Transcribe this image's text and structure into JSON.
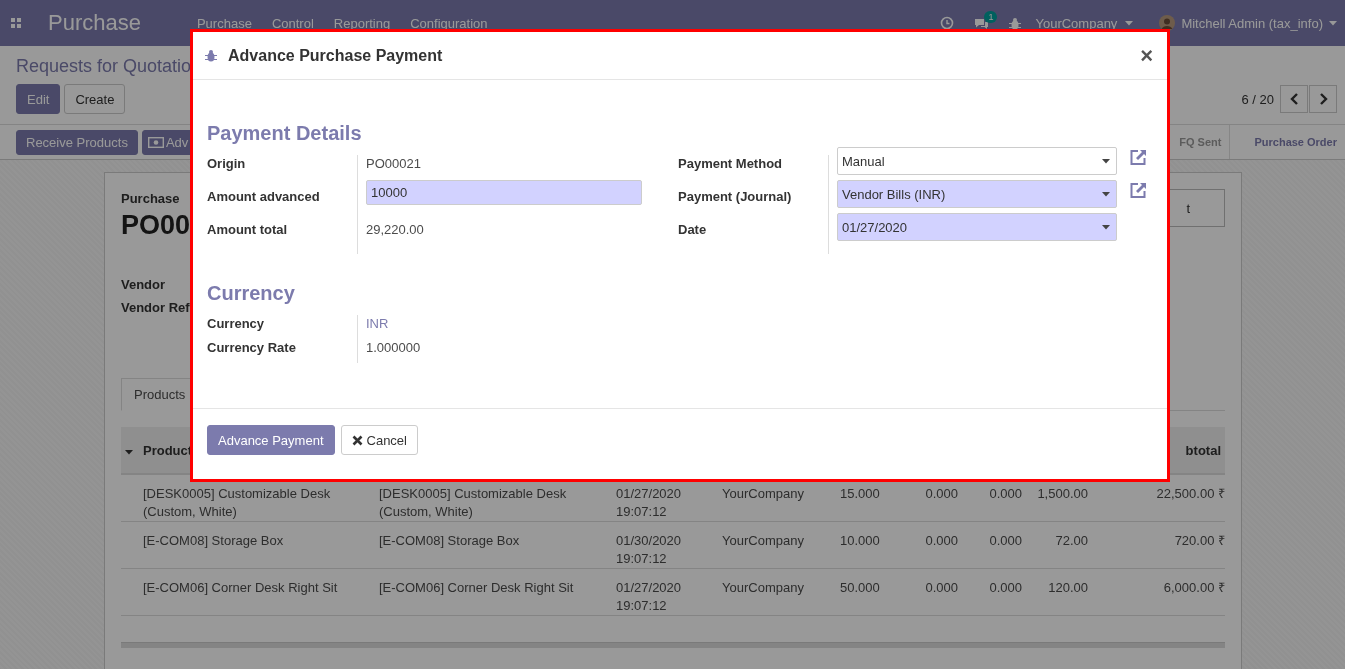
{
  "navbar": {
    "app_title": "Purchase",
    "menu": [
      "Purchase",
      "Control",
      "Reporting",
      "Configuration"
    ],
    "chat_count": "1",
    "company": "YourCompany",
    "user": "Mitchell Admin (tax_info)"
  },
  "control_panel": {
    "breadcrumb": "Requests for Quotatio",
    "buttons": [
      {
        "label": "Edit",
        "kind": "primary"
      },
      {
        "label": "Create",
        "kind": "secondary"
      }
    ],
    "pager": "6 / 20"
  },
  "action_bar": {
    "buttons": [
      {
        "label": "Receive Products",
        "kind": "plain"
      },
      {
        "label": "Adv",
        "kind": "money"
      }
    ],
    "statusbar": [
      {
        "label": "FQ Sent",
        "selected": false
      },
      {
        "label": "Purchase Order",
        "selected": true
      }
    ]
  },
  "sheet": {
    "subtitle": "Purchase",
    "name": "PO00",
    "fields": [
      "Vendor",
      "Vendor Ref"
    ],
    "smart_button": "t",
    "tabs": [
      {
        "label": "Products",
        "selected": true
      }
    ],
    "table": {
      "columns": [
        "Product",
        "btotal"
      ],
      "rows": [
        {
          "product": "[DESK0005] Customizable Desk (Custom, White)",
          "description": "[DESK0005] Customizable Desk (Custom, White)",
          "date": "01/27/2020 19:07:12",
          "company": "YourCompany",
          "qty": "15.000",
          "col_6": "0.000",
          "col_7": "0.000",
          "price": "1,500.00",
          "subtotal": "22,500.00 ₹"
        },
        {
          "product": "[E-COM08] Storage Box",
          "description": "[E-COM08] Storage Box",
          "date": "01/30/2020 19:07:12",
          "company": "YourCompany",
          "qty": "10.000",
          "col_6": "0.000",
          "col_7": "0.000",
          "price": "72.00",
          "subtotal": "720.00 ₹"
        },
        {
          "product": "[E-COM06] Corner Desk Right Sit",
          "description": "[E-COM06] Corner Desk Right Sit",
          "date": "01/27/2020 19:07:12",
          "company": "YourCompany",
          "qty": "50.000",
          "col_6": "0.000",
          "col_7": "0.000",
          "price": "120.00",
          "subtotal": "6,000.00 ₹"
        }
      ]
    }
  },
  "dialog": {
    "title": "Advance Purchase Payment",
    "close": "×",
    "sections": [
      {
        "title": "Payment Details",
        "left": [
          {
            "label": "Origin",
            "kind": "text",
            "value": "PO00021"
          },
          {
            "label": "Amount advanced",
            "kind": "input",
            "value": "10000",
            "required": true
          },
          {
            "label": "Amount total",
            "kind": "text",
            "value": "29,220.00"
          }
        ],
        "right": [
          {
            "label": "Payment Method",
            "kind": "select",
            "value": "Manual",
            "required": false,
            "external_link": true
          },
          {
            "label": "Payment (Journal)",
            "kind": "select",
            "value": "Vendor Bills (INR)",
            "required": true,
            "external_link": true
          },
          {
            "label": "Date",
            "kind": "select",
            "value": "01/27/2020",
            "required": true,
            "external_link": false
          }
        ]
      },
      {
        "title": "Currency",
        "left": [
          {
            "label": "Currency",
            "kind": "link",
            "value": "INR"
          },
          {
            "label": "Currency Rate",
            "kind": "text",
            "value": "1.000000"
          }
        ]
      }
    ],
    "buttons": [
      {
        "label": "Advance Payment",
        "kind": "primary"
      },
      {
        "label": "Cancel",
        "kind": "cancel"
      }
    ]
  }
}
